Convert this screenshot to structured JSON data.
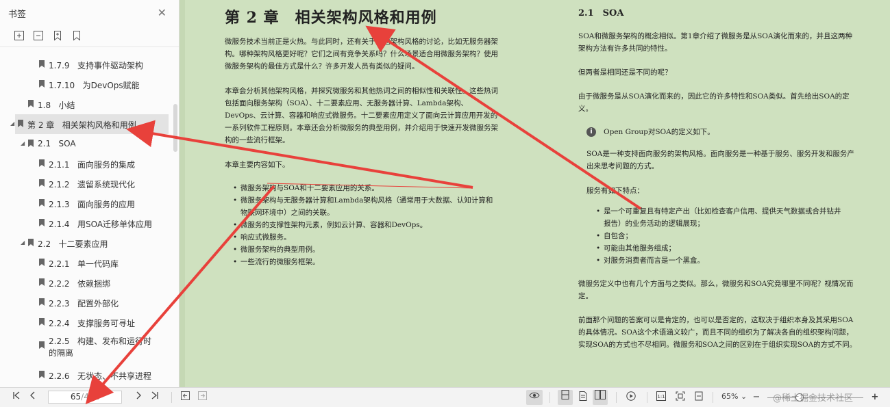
{
  "sidebar": {
    "title": "书签",
    "tools": [
      "expand-all-icon",
      "collapse-all-icon",
      "add-bookmark-icon",
      "bookmark-icon"
    ],
    "items": [
      {
        "num": "1.7.9",
        "text": "支持事件驱动架构",
        "level": 3
      },
      {
        "num": "1.7.10",
        "text": "为DevOps赋能",
        "level": 3
      },
      {
        "num": "1.8",
        "text": "小结",
        "level": 2
      },
      {
        "num": "第 2 章",
        "text": "相关架构风格和用例",
        "level": 1,
        "expanded": true,
        "selected": true
      },
      {
        "num": "2.1",
        "text": "SOA",
        "level": 2,
        "expanded": true
      },
      {
        "num": "2.1.1",
        "text": "面向服务的集成",
        "level": 3
      },
      {
        "num": "2.1.2",
        "text": "遗留系统现代化",
        "level": 3
      },
      {
        "num": "2.1.3",
        "text": "面向服务的应用",
        "level": 3
      },
      {
        "num": "2.1.4",
        "text": "用SOA迁移单体应用",
        "level": 3
      },
      {
        "num": "2.2",
        "text": "十二要素应用",
        "level": 2,
        "expanded": true
      },
      {
        "num": "2.2.1",
        "text": "单一代码库",
        "level": 3
      },
      {
        "num": "2.2.2",
        "text": "依赖捆绑",
        "level": 3
      },
      {
        "num": "2.2.3",
        "text": "配置外部化",
        "level": 3
      },
      {
        "num": "2.2.4",
        "text": "支撑服务可寻址",
        "level": 3
      },
      {
        "num": "2.2.5",
        "text": "构建、发布和运行时的隔离",
        "level": 3
      },
      {
        "num": "2.2.6",
        "text": "无状态、不共享进程",
        "level": 3
      }
    ]
  },
  "doc": {
    "left": {
      "chapter_title": "第 2 章　相关架构风格和用例",
      "para1": "微服务技术当前正是火热。与此同时，还有关于其他架构风格的讨论，比如无服务器架构。哪种架构风格更好呢？它们之间有竞争关系吗？什么场景适合用微服务架构？使用微服务架构的最佳方式是什么？许多开发人员有类似的疑问。",
      "para2": "本章会分析其他架构风格，并探究微服务和其他热词之间的相似性和关联性。这些热词包括面向服务架构（SOA）、十二要素应用、无服务器计算、Lambda架构、DevOps、云计算、容器和响应式微服务。十二要素应用定义了面向云计算应用开发的一系列软件工程原则。本章还会分析微服务的典型用例，并介绍用于快速开发微服务架构的一些流行框架。",
      "para3": "本章主要内容如下。",
      "bullets": [
        "微服务架构与SOA和十二要素应用的关系。",
        "微服务架构与无服务器计算和Lambda架构风格（通常用于大数据、认知计算和物联网环境中）之间的关联。",
        "微服务的支撑性架构元素，例如云计算、容器和DevOps。",
        "响应式微服务。",
        "微服务架构的典型用例。",
        "一些流行的微服务框架。"
      ]
    },
    "right": {
      "section_title": "2.1　SOA",
      "para1": "SOA和微服务架构的概念相似。第1章介绍了微服务是从SOA演化而来的，并且这两种架构方法有许多共同的特性。",
      "para2": "但两者是相同还是不同的呢？",
      "para3": "由于微服务是从SOA演化而来的，因此它的许多特性和SOA类似。首先给出SOA的定义。",
      "note_icon": "info-icon",
      "note": "Open Group对SOA的定义如下。",
      "quote": "SOA是一种支持面向服务的架构风格。面向服务是一种基于服务、服务开发和服务产出来思考问题的方式。",
      "features_intro": "服务有如下特点：",
      "features": [
        "是一个可重复且有特定产出（比如检查客户信用、提供天气数据或合并钻井报告）的业务活动的逻辑展现；",
        "自包含；",
        "可能由其他服务组成；",
        "对服务消费者而言是一个黑盒。"
      ],
      "para4": "微服务定义中也有几个方面与之类似。那么，微服务和SOA究竟哪里不同呢？视情况而定。",
      "para5": "前面那个问题的答案可以是肯定的，也可以是否定的，这取决于组织本身及其采用SOA的具体情况。SOA这个术语涵义较广，而且不同的组织为了解决各自的组织架构问题，实现SOA的方式也不尽相同。微服务和SOA之间的区别在于组织实现SOA的方式不同。"
    }
  },
  "statusbar": {
    "page_current": "65",
    "page_total": "/442",
    "zoom": "65%",
    "watermark": "@稀土掘金技术社区"
  },
  "colors": {
    "doc_background": "#cfe1bf",
    "annotation_arrow": "#e8413b",
    "selected_row": "#e3e3e3"
  }
}
